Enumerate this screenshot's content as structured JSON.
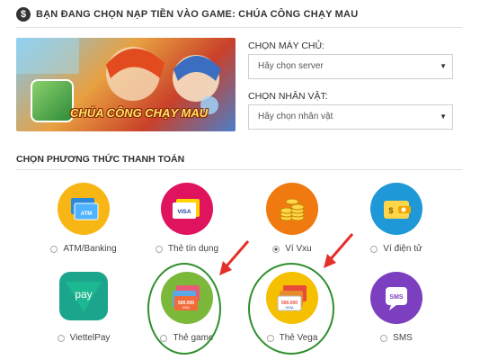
{
  "header": {
    "icon": "dollar-icon",
    "title": "BẠN ĐANG CHỌN NẠP TIỀN VÀO GAME: CHÚA CÔNG CHẠY MAU"
  },
  "banner": {
    "title": "CHÚA CÔNG CHẠY MAU"
  },
  "server": {
    "label": "CHỌN MÁY CHỦ:",
    "value": "Hãy chọn server"
  },
  "character": {
    "label": "CHỌN NHÂN VẬT:",
    "value": "Hãy chọn nhân vật"
  },
  "payment": {
    "title": "CHỌN PHƯƠNG THỨC THANH TOÁN",
    "selected": "Ví Vxu",
    "methods": [
      {
        "label": "ATM/Banking",
        "icon": "atm-card-icon",
        "color": "#f7b614"
      },
      {
        "label": "Thẻ tín dụng",
        "icon": "visa-card-icon",
        "color": "#e0135e"
      },
      {
        "label": "Ví Vxu",
        "icon": "coins-icon",
        "color": "#f07a10"
      },
      {
        "label": "Ví điện tử",
        "icon": "wallet-icon",
        "color": "#1e98d6"
      },
      {
        "label": "ViettelPay",
        "icon": "viettelpay-icon",
        "color": "#1aa58c"
      },
      {
        "label": "Thẻ game",
        "icon": "game-card-icon",
        "color": "#7cb83a"
      },
      {
        "label": "Thẻ Vega",
        "icon": "vega-card-icon",
        "color": "#f5c000"
      },
      {
        "label": "SMS",
        "icon": "sms-icon",
        "color": "#7b3fbf"
      }
    ]
  },
  "card_text": {
    "value_500k": "500.000",
    "vnd": "VND",
    "visa": "VISA",
    "sms": "SMS",
    "pay": "pay",
    "atm": "ATM"
  }
}
